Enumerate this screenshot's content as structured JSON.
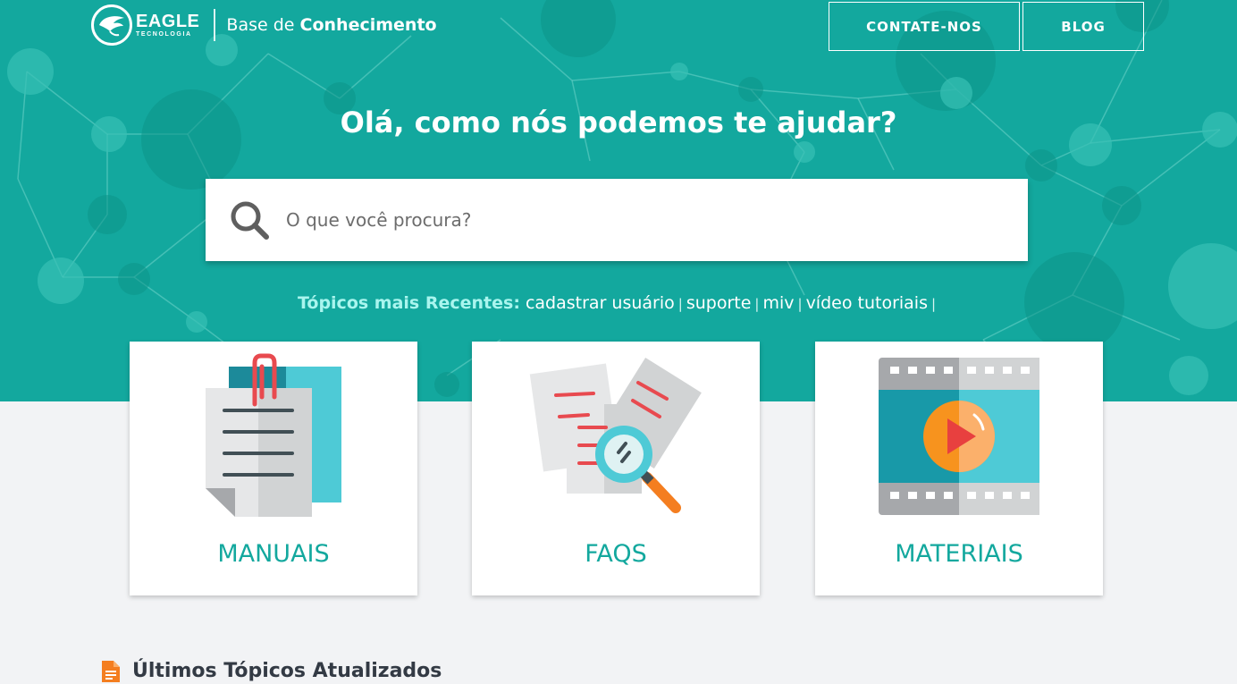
{
  "header": {
    "logo_main": "EAGLE",
    "logo_sub": "TECNOLOGIA",
    "kb_prefix": "Base de",
    "kb_bold": "Conhecimento",
    "nav": [
      {
        "label": "CONTATE-NOS"
      },
      {
        "label": "BLOG"
      }
    ]
  },
  "hero": {
    "headline": "Olá, como nós podemos te ajudar?"
  },
  "search": {
    "placeholder": "O que você procura?",
    "value": ""
  },
  "recent_topics": {
    "label": "Tópicos mais Recentes:",
    "items": [
      "cadastrar usuário",
      "suporte",
      "miv",
      "vídeo tutoriais"
    ],
    "separator": "|"
  },
  "cards": [
    {
      "label": "MANUAIS",
      "icon": "documents-clip-icon"
    },
    {
      "label": "FAQS",
      "icon": "document-search-icon"
    },
    {
      "label": "MATERIAIS",
      "icon": "video-film-icon"
    }
  ],
  "latest": {
    "title": "Últimos Tópicos Atualizados",
    "icon": "document-icon"
  },
  "colors": {
    "teal": "#13a89e",
    "accent_light": "#a9f5ee",
    "background": "#f2f3f5",
    "orange": "#f47e20",
    "red": "#e84a4f"
  }
}
